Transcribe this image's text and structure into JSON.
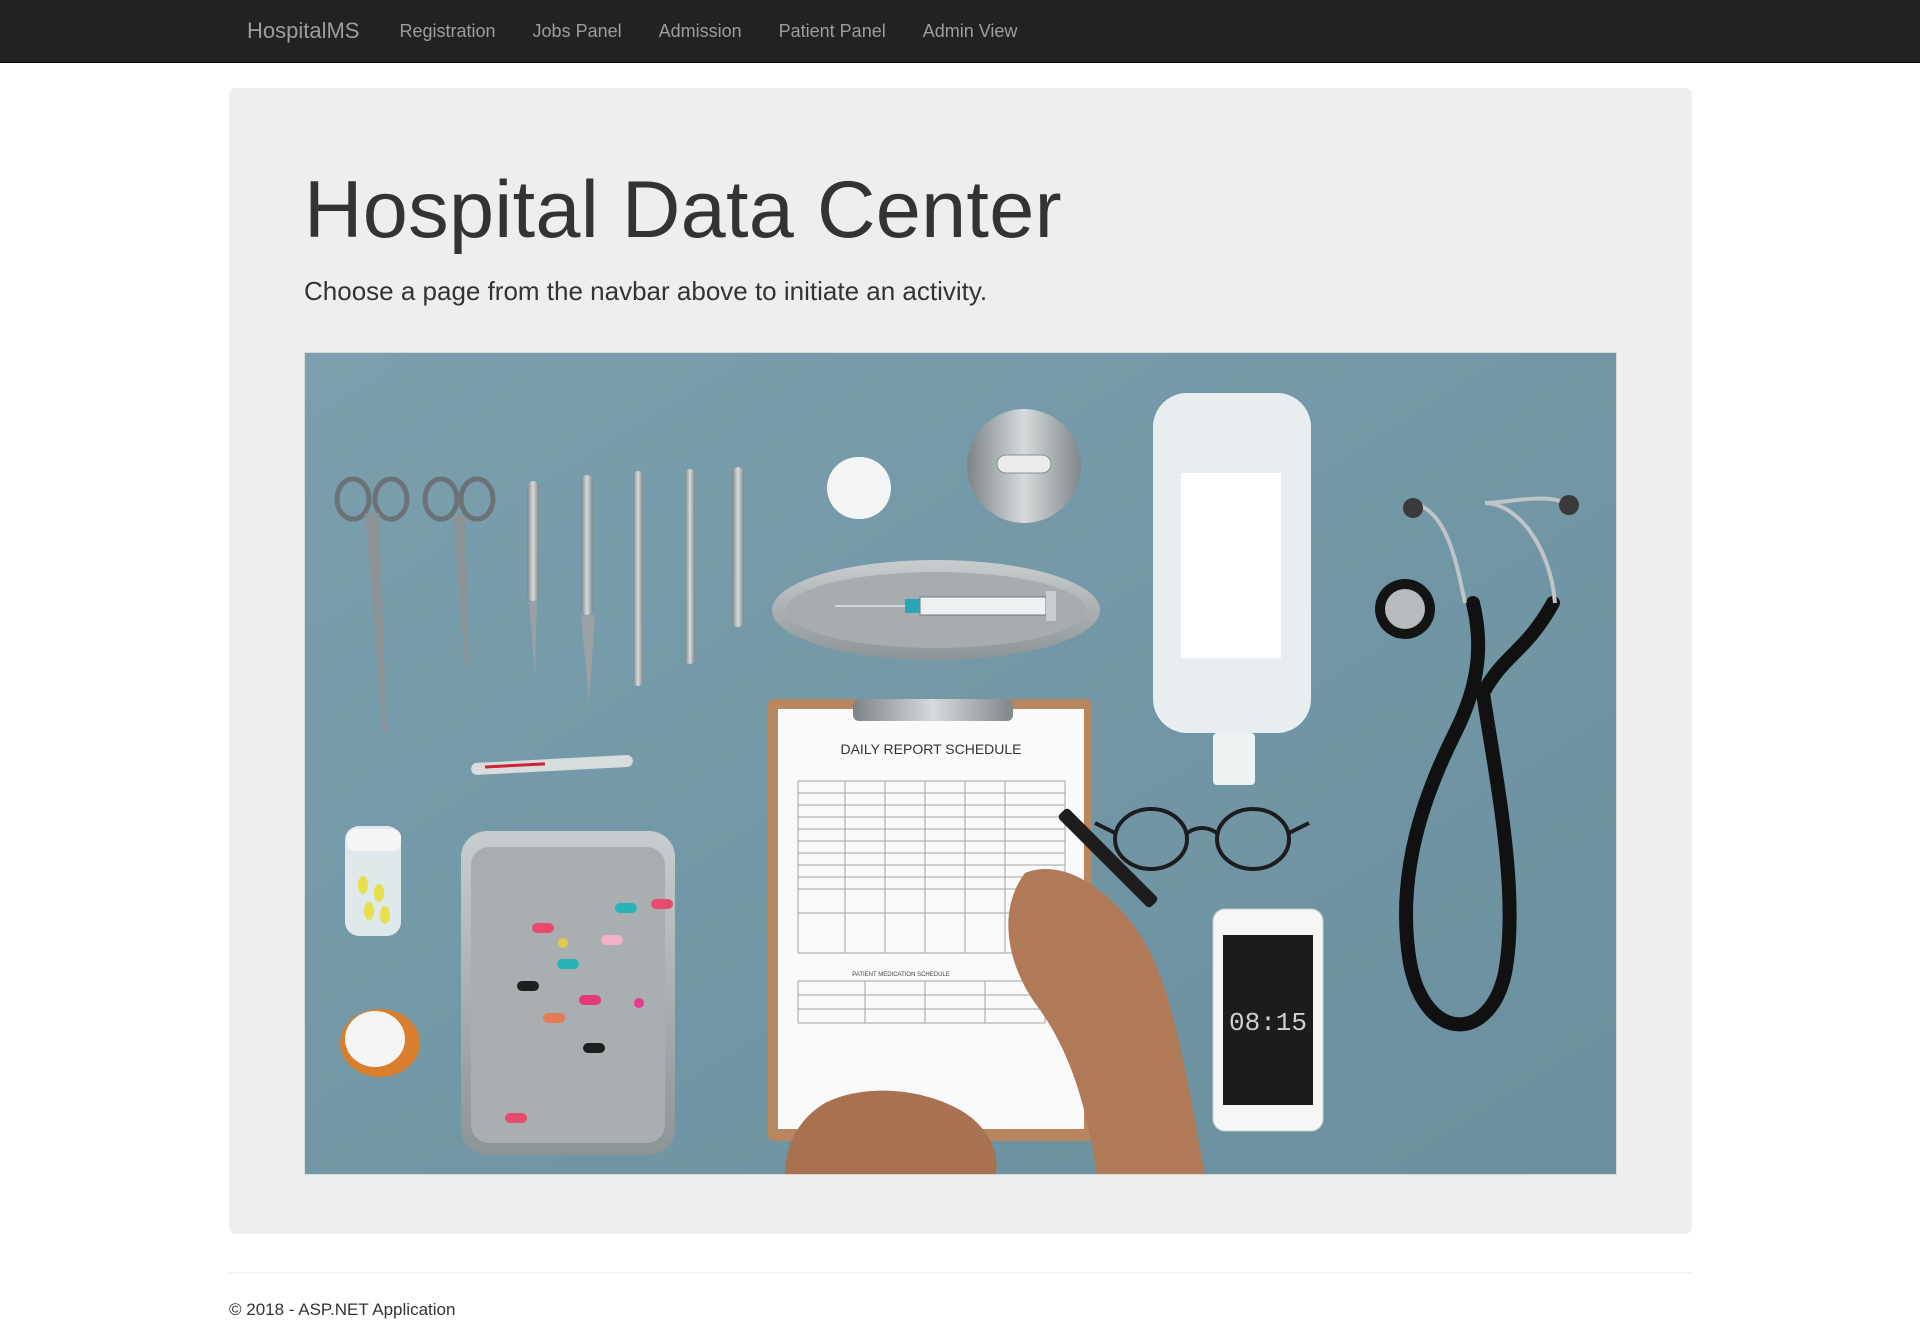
{
  "navbar": {
    "brand": "HospitalMS",
    "items": [
      {
        "label": "Registration"
      },
      {
        "label": "Jobs Panel"
      },
      {
        "label": "Admission"
      },
      {
        "label": "Patient Panel"
      },
      {
        "label": "Admin View"
      }
    ]
  },
  "jumbotron": {
    "title": "Hospital Data Center",
    "lead": "Choose a page from the navbar above to initiate an activity."
  },
  "hero_image": {
    "clipboard_title": "DAILY REPORT SCHEDULE",
    "medication_table_title": "PATIENT MEDICATION SCHEDULE",
    "phone_time": "08:15",
    "colors": {
      "background": "#6f97a6",
      "steel": "#a9aeb0",
      "paper": "#fafafa"
    }
  },
  "footer": {
    "text": "© 2018 - ASP.NET Application"
  }
}
